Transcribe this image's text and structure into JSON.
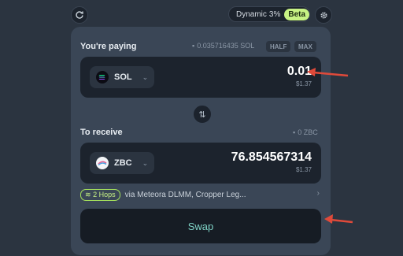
{
  "header": {
    "slippage_mode": "Dynamic",
    "slippage_value": "3%",
    "beta_label": "Beta"
  },
  "pay": {
    "label": "You're paying",
    "balance": "0.035716435 SOL",
    "half_label": "HALF",
    "max_label": "MAX",
    "token": "SOL",
    "amount": "0.01",
    "usd": "$1.37"
  },
  "receive": {
    "label": "To receive",
    "balance": "0 ZBC",
    "token": "ZBC",
    "amount": "76.854567314",
    "usd": "$1.37"
  },
  "route": {
    "hops": "2 Hops",
    "via": "via Meteora DLMM, Cropper Leg..."
  },
  "swap": {
    "label": "Swap"
  },
  "colors": {
    "accent_green": "#c7f284",
    "swap_text": "#7fd3c6",
    "annotation_arrow": "#e04a3a"
  }
}
